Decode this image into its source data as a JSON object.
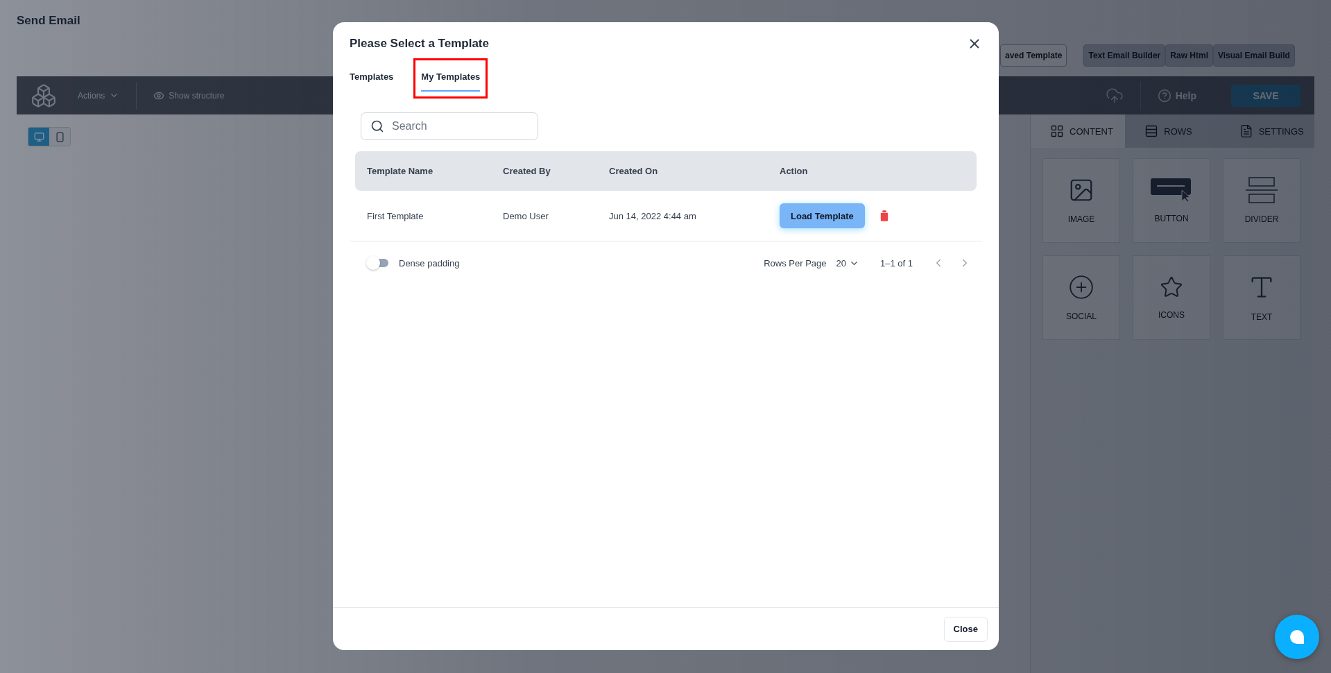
{
  "page": {
    "title": "Send Email"
  },
  "editor_tabs": [
    {
      "label": "aved Template",
      "selected": true
    },
    {
      "label": "Text Email Builder",
      "selected": false
    },
    {
      "label": "Raw Html",
      "selected": false
    },
    {
      "label": "Visual Email Build",
      "selected": false
    }
  ],
  "toolbar": {
    "actions": "Actions",
    "show_structure": "Show structure",
    "help": "Help",
    "save": "SAVE"
  },
  "device_toggle": [
    {
      "kind": "desktop",
      "selected": true
    },
    {
      "kind": "mobile",
      "selected": false
    }
  ],
  "panel_tabs": [
    {
      "label": "CONTENT",
      "kind": "grid",
      "selected": true
    },
    {
      "label": "ROWS",
      "kind": "rows",
      "selected": false
    },
    {
      "label": "SETTINGS",
      "kind": "settings",
      "selected": false
    }
  ],
  "blocks": [
    {
      "label": "IMAGE",
      "kind": "image"
    },
    {
      "label": "BUTTON",
      "kind": "button"
    },
    {
      "label": "DIVIDER",
      "kind": "divider"
    },
    {
      "label": "SOCIAL",
      "kind": "social"
    },
    {
      "label": "ICONS",
      "kind": "icons"
    },
    {
      "label": "TEXT",
      "kind": "text"
    }
  ],
  "modal": {
    "title": "Please Select a Template",
    "tabs": [
      {
        "label": "Templates",
        "selected": false,
        "highlighted": false
      },
      {
        "label": "My Templates",
        "selected": true,
        "highlighted": true
      }
    ],
    "search": {
      "placeholder": "Search"
    },
    "table": {
      "columns": [
        "Template Name",
        "Created By",
        "Created On",
        "Action"
      ],
      "rows": [
        {
          "name": "First Template",
          "created_by": "Demo User",
          "created_on": "Jun 14, 2022 4:44 am",
          "action": "Load Template"
        }
      ]
    },
    "dense_padding": {
      "label": "Dense padding",
      "on": false
    },
    "pagination": {
      "rows_per_page_label": "Rows Per Page",
      "rows_per_page": "20",
      "range": "1–1 of 1"
    },
    "close_button": "Close"
  }
}
